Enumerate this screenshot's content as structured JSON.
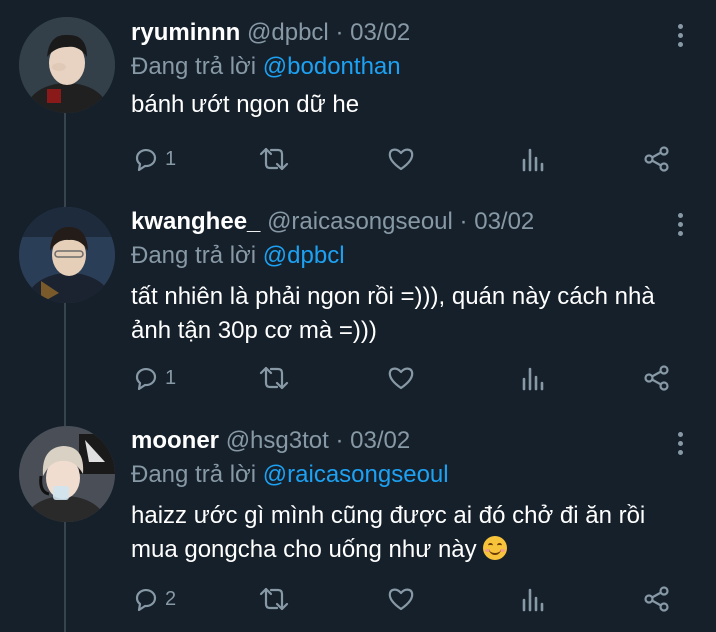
{
  "replying_label": "Đang trả lời",
  "tweets": [
    {
      "name": "ryuminnn",
      "handle": "@dpbcl",
      "separator": "·",
      "date": "03/02",
      "reply_to": "@bodonthan",
      "text": "bánh ướt ngon dữ he",
      "reply_count": "1",
      "avatar_colors": {
        "bg": "#33404a",
        "face": "#e8d3c2",
        "hair": "#1a1a1a",
        "shirt": "#202020"
      }
    },
    {
      "name": "kwanghee_",
      "handle": "@raicasongseoul",
      "separator": "·",
      "date": "03/02",
      "reply_to": "@dpbcl",
      "text": "tất nhiên là phải ngon rồi =))), quán này cách nhà ảnh tận 30p cơ mà =)))",
      "reply_count": "1",
      "avatar_colors": {
        "bg": "#2b3e57",
        "face": "#e6cfb8",
        "hair": "#241c18",
        "shirt": "#1b2230"
      }
    },
    {
      "name": "mooner",
      "handle": "@hsg3tot",
      "separator": "·",
      "date": "03/02",
      "reply_to": "@raicasongseoul",
      "text": "haizz ước gì mình cũng được ai đó chở đi ăn rồi mua gongcha cho uống như này",
      "has_emoji": true,
      "reply_count": "2",
      "avatar_colors": {
        "bg": "#4a4f57",
        "face": "#f0ddd0",
        "hair": "#d9d2c4",
        "shirt": "#2a2a2a"
      }
    }
  ],
  "colors": {
    "background": "#15202b",
    "muted": "#8899a6",
    "accent": "#1da1f2",
    "text": "#ffffff"
  },
  "icons": [
    "reply-icon",
    "retweet-icon",
    "like-icon",
    "analytics-icon",
    "share-icon",
    "more-icon"
  ]
}
